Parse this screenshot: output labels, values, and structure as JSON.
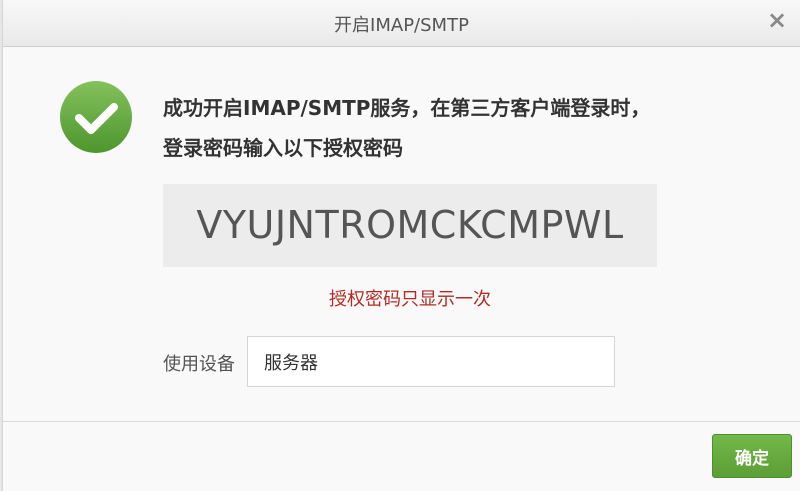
{
  "dialog": {
    "title": "开启IMAP/SMTP",
    "close_icon": "close-icon"
  },
  "content": {
    "success_icon": "checkmark-circle-icon",
    "message": "成功开启IMAP/SMTP服务，在第三方客户端登录时，登录密码输入以下授权密码",
    "auth_code": "VYUJNTROMCKCMPWL",
    "note": "授权密码只显示一次",
    "device_label": "使用设备",
    "device_value": "服务器"
  },
  "footer": {
    "ok_label": "确定"
  },
  "colors": {
    "accent_green": "#66aa3f",
    "warning_red": "#b42a23"
  }
}
